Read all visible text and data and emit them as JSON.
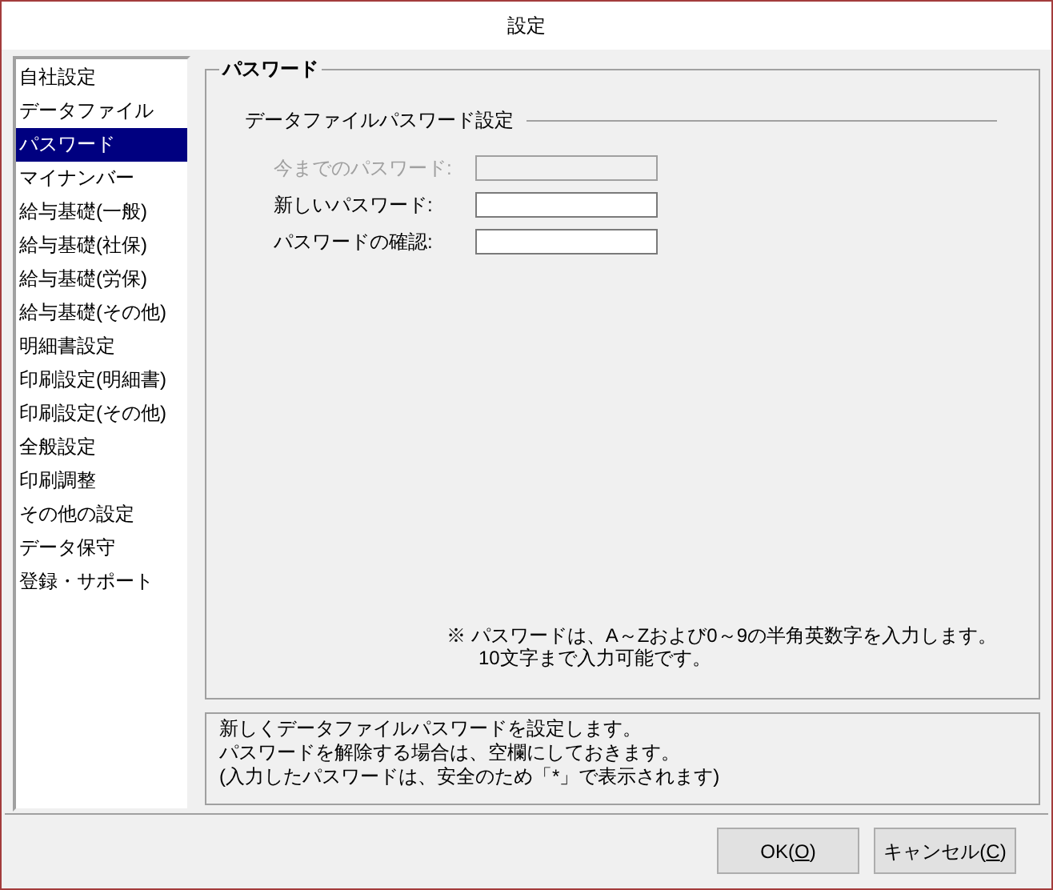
{
  "window": {
    "title": "設定"
  },
  "sidebar": {
    "items": [
      {
        "label": "自社設定",
        "selected": false
      },
      {
        "label": "データファイル",
        "selected": false
      },
      {
        "label": "パスワード",
        "selected": true
      },
      {
        "label": "マイナンバー",
        "selected": false
      },
      {
        "label": "給与基礎(一般)",
        "selected": false
      },
      {
        "label": "給与基礎(社保)",
        "selected": false
      },
      {
        "label": "給与基礎(労保)",
        "selected": false
      },
      {
        "label": "給与基礎(その他)",
        "selected": false
      },
      {
        "label": "明細書設定",
        "selected": false
      },
      {
        "label": "印刷設定(明細書)",
        "selected": false
      },
      {
        "label": "印刷設定(その他)",
        "selected": false
      },
      {
        "label": "全般設定",
        "selected": false
      },
      {
        "label": "印刷調整",
        "selected": false
      },
      {
        "label": "その他の設定",
        "selected": false
      },
      {
        "label": "データ保守",
        "selected": false
      },
      {
        "label": "登録・サポート",
        "selected": false
      }
    ]
  },
  "panel": {
    "title": "パスワード",
    "section": "データファイルパスワード設定",
    "fields": [
      {
        "label": "今までのパスワード:",
        "disabled": true
      },
      {
        "label": "新しいパスワード:",
        "disabled": false
      },
      {
        "label": "パスワードの確認:",
        "disabled": false
      }
    ],
    "notes": [
      "※ パスワードは、A～Zおよび0～9の半角英数字を入力します。",
      "10文字まで入力可能です。"
    ]
  },
  "description": [
    "新しくデータファイルパスワードを設定します。",
    "パスワードを解除する場合は、空欄にしておきます。",
    "(入力したパスワードは、安全のため「*」で表示されます)"
  ],
  "buttons": [
    {
      "before": "OK(",
      "accel": "O",
      "after": ")"
    },
    {
      "before": "キャンセル(",
      "accel": "C",
      "after": ")"
    }
  ]
}
